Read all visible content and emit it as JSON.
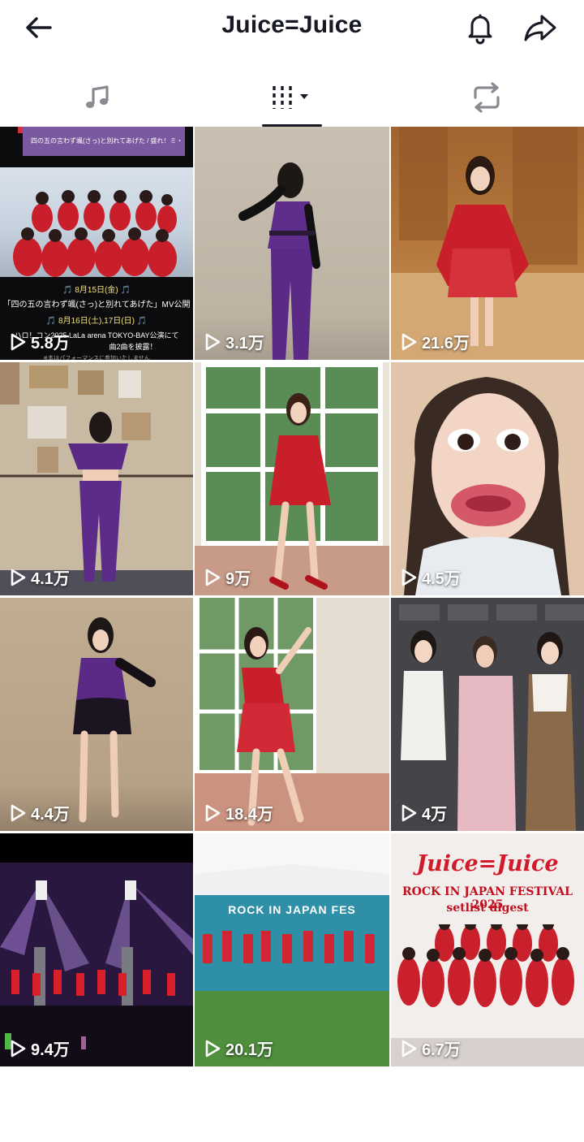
{
  "header": {
    "title": "Juice=Juice",
    "back_icon": "back-arrow-icon",
    "bell_icon": "bell-icon",
    "share_icon": "share-icon"
  },
  "tabs": [
    {
      "icon": "music-note-icon",
      "active": false
    },
    {
      "icon": "filter-sort-icon",
      "active": true
    },
    {
      "icon": "repost-icon",
      "active": false
    }
  ],
  "videos": [
    {
      "views": "5.8万",
      "overlay": [
        "四の五の言わず颯(さっ)と別れてあげた / 盛れ！ミ・アモーレ",
        "🎵 8月15日(金) 🎵",
        "「四の五の言わず颯(さっ)と別れてあげた」MV公開",
        "🎵 8月16日(土),17日(日) 🎵",
        "ハロ！コン2025 LaLa arena TOKYO-BAY公演にて",
        "曲2曲を披露！",
        "※本はパフォーマンスに参加いたしません"
      ]
    },
    {
      "views": "3.1万"
    },
    {
      "views": "21.6万"
    },
    {
      "views": "4.1万"
    },
    {
      "views": "9万"
    },
    {
      "views": "4.5万"
    },
    {
      "views": "4.4万"
    },
    {
      "views": "18.4万"
    },
    {
      "views": "4万"
    },
    {
      "views": "9.4万"
    },
    {
      "views": "20.1万",
      "banner": "ROCK IN JAPAN FES"
    },
    {
      "views": "6.7万",
      "brand": "Juice=Juice",
      "line1": "ROCK IN JAPAN FESTIVAL 2025",
      "line2": "setlist digest"
    }
  ],
  "colors": {
    "text": "#161823",
    "active_underline": "#161823",
    "tab_icon_inactive": "#8a8b91"
  }
}
